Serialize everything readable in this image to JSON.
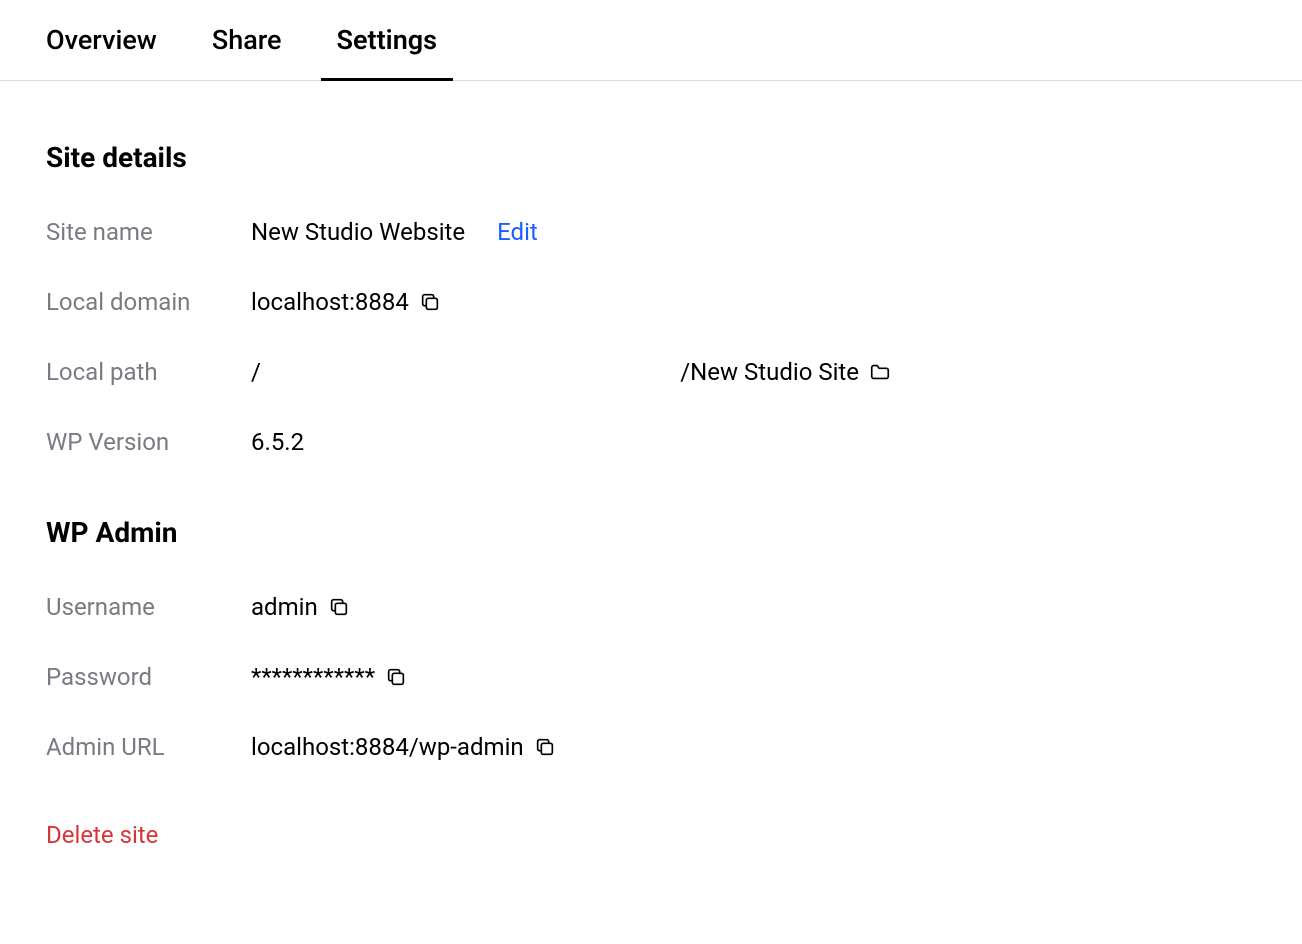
{
  "tabs": [
    {
      "label": "Overview",
      "active": false
    },
    {
      "label": "Share",
      "active": false
    },
    {
      "label": "Settings",
      "active": true
    }
  ],
  "site_details": {
    "title": "Site details",
    "site_name": {
      "label": "Site name",
      "value": "New Studio Website",
      "edit_label": "Edit"
    },
    "local_domain": {
      "label": "Local domain",
      "value": "localhost:8884"
    },
    "local_path": {
      "label": "Local path",
      "left": "/",
      "right": "/New Studio Site"
    },
    "wp_version": {
      "label": "WP Version",
      "value": "6.5.2"
    }
  },
  "wp_admin": {
    "title": "WP Admin",
    "username": {
      "label": "Username",
      "value": "admin"
    },
    "password": {
      "label": "Password",
      "value": "************"
    },
    "admin_url": {
      "label": "Admin URL",
      "value": "localhost:8884/wp-admin"
    }
  },
  "delete_label": "Delete site"
}
